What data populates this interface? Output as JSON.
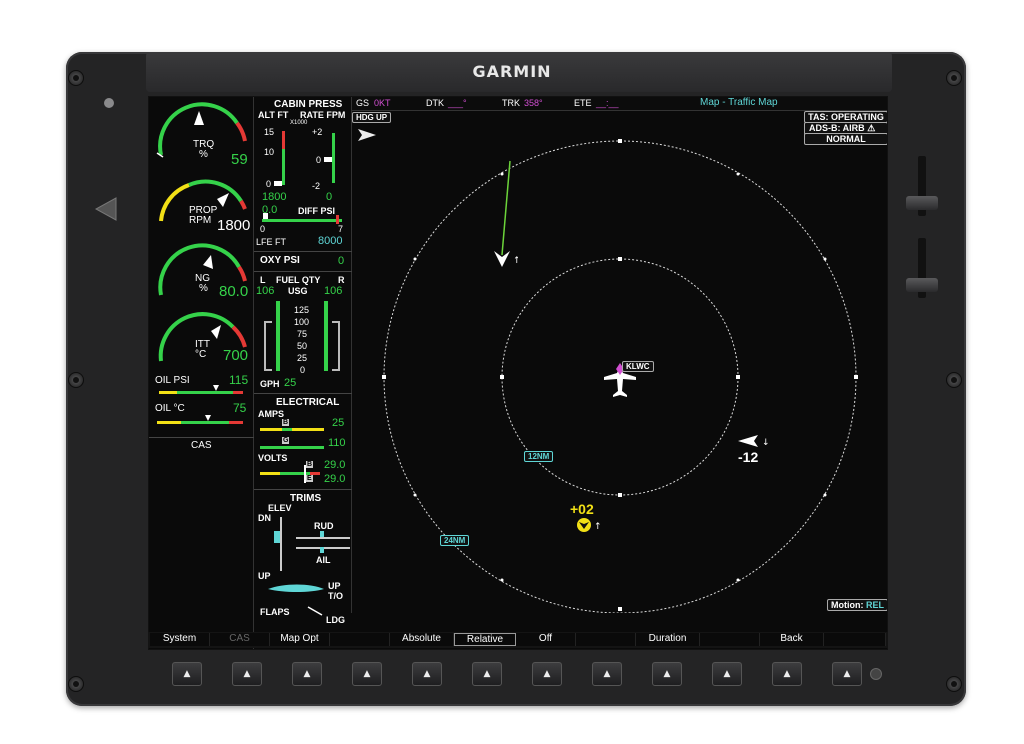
{
  "brand": "GARMIN",
  "header": {
    "gs_label": "GS",
    "gs_value": "0KT",
    "dtk_label": "DTK",
    "dtk_value": "___°",
    "trk_label": "TRK",
    "trk_value": "358°",
    "ete_label": "ETE",
    "ete_value": "__:__",
    "page_title": "Map - Traffic Map"
  },
  "map": {
    "orientation": "HDG UP",
    "tas_status": "TAS: OPERATING",
    "adsb_status": "ADS-B: AIRB",
    "mode_status": "NORMAL",
    "ownship_label": "KLWC",
    "inner_ring_label": "12NM",
    "outer_ring_label": "24NM",
    "traffic_1_alt": "-12",
    "traffic_2_alt": "+02",
    "motion_label": "Motion:",
    "motion_value": "REL"
  },
  "engine": {
    "trq_label": "TRQ",
    "trq_unit": "%",
    "trq_value": "59",
    "prop_label": "PROP",
    "prop_unit": "RPM",
    "prop_value": "1800",
    "ng_label": "NG",
    "ng_unit": "%",
    "ng_value": "80.0",
    "itt_label": "ITT",
    "itt_unit": "°C",
    "itt_value": "700",
    "oil_psi_label": "OIL PSI",
    "oil_psi_value": "115",
    "oil_c_label": "OIL °C",
    "oil_c_value": "75",
    "cas_label": "CAS"
  },
  "cabin": {
    "title": "CABIN PRESS",
    "alt_label": "ALT FT",
    "rate_label": "RATE FPM",
    "x1000": "X1000",
    "scale_15": "15",
    "scale_10": "10",
    "scale_0": "0",
    "rate_p2": "+2",
    "rate_0": "0",
    "rate_m2": "-2",
    "alt_value": "1800",
    "rate_value": "0",
    "diff_value": "0.0",
    "diff_label": "DIFF PSI",
    "diff_min": "0",
    "diff_max": "7",
    "lfe_label": "LFE FT",
    "lfe_value": "8000"
  },
  "oxy": {
    "label": "OXY PSI",
    "value": "0"
  },
  "fuel": {
    "l": "L",
    "title": "FUEL QTY",
    "r": "R",
    "l_value": "106",
    "unit": "USG",
    "r_value": "106",
    "scale": [
      "125",
      "100",
      "75",
      "50",
      "25",
      "0"
    ],
    "gph_label": "GPH",
    "gph_value": "25"
  },
  "electrical": {
    "title": "ELECTRICAL",
    "amps_label": "AMPS",
    "amps_b": "25",
    "amps_g": "110",
    "b_tag": "B",
    "g_tag": "G",
    "e_tag": "E",
    "volts_label": "VOLTS",
    "volts_b": "29.0",
    "volts_e": "29.0"
  },
  "trims": {
    "title": "TRIMS",
    "elev": "ELEV",
    "dn": "DN",
    "up": "UP",
    "rud": "RUD",
    "ail": "AIL",
    "pitch_up": "UP",
    "to": "T/O",
    "flaps": "FLAPS",
    "ldg": "LDG"
  },
  "softkeys": [
    "System",
    "CAS",
    "Map Opt",
    "",
    "Absolute",
    "Relative",
    "Off",
    "",
    "Duration",
    "",
    "Back",
    ""
  ]
}
